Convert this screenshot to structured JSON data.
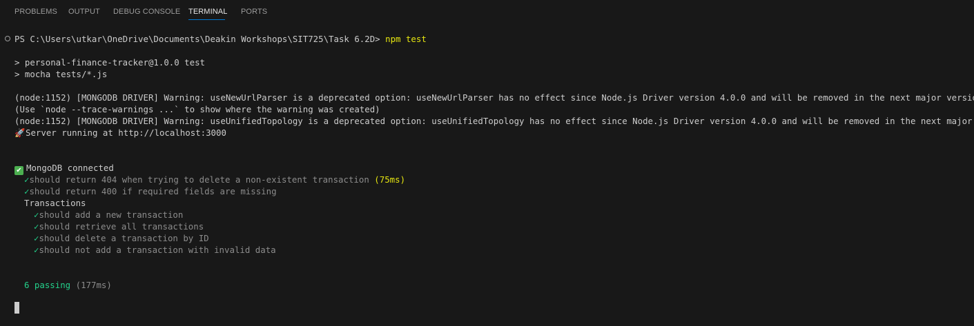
{
  "panel": {
    "tabs": [
      "PROBLEMS",
      "OUTPUT",
      "DEBUG CONSOLE",
      "TERMINAL",
      "PORTS"
    ],
    "active_tab": "TERMINAL"
  },
  "terminal": {
    "prompt_path": "PS C:\\Users\\utkar\\OneDrive\\Documents\\Deakin Workshops\\SIT725\\Task 6.2D>",
    "command": "npm test",
    "script_name": "> personal-finance-tracker@1.0.0 test",
    "script_cmd": "> mocha tests/*.js",
    "warn1": "(node:1152) [MONGODB DRIVER] Warning: useNewUrlParser is a deprecated option: useNewUrlParser has no effect since Node.js Driver version 4.0.0 and will be removed in the next major version",
    "warn_hint": "(Use `node --trace-warnings ...` to show where the warning was created)",
    "warn2": "(node:1152) [MONGODB DRIVER] Warning: useUnifiedTopology is a deprecated option: useUnifiedTopology has no effect since Node.js Driver version 4.0.0 and will be removed in the next major version",
    "server_msg": "Server running at http://localhost:3000",
    "mongo_msg": "MongoDB connected",
    "check_mark": "✓",
    "tests_top": [
      {
        "title": "should return 404 when trying to delete a non-existent transaction",
        "duration": "(75ms)"
      },
      {
        "title": "should return 400 if required fields are missing"
      }
    ],
    "suite": "Transactions",
    "suite_tests": [
      "should add a new transaction",
      "should retrieve all transactions",
      "should delete a transaction by ID",
      "should not add a transaction with invalid data"
    ],
    "passing": "6 passing",
    "passing_time": "(177ms)"
  },
  "colors": {
    "background": "#181818",
    "text": "#cccccc",
    "command": "#e5e510",
    "success": "#23d18b",
    "tab_active_border": "#0078d4"
  }
}
